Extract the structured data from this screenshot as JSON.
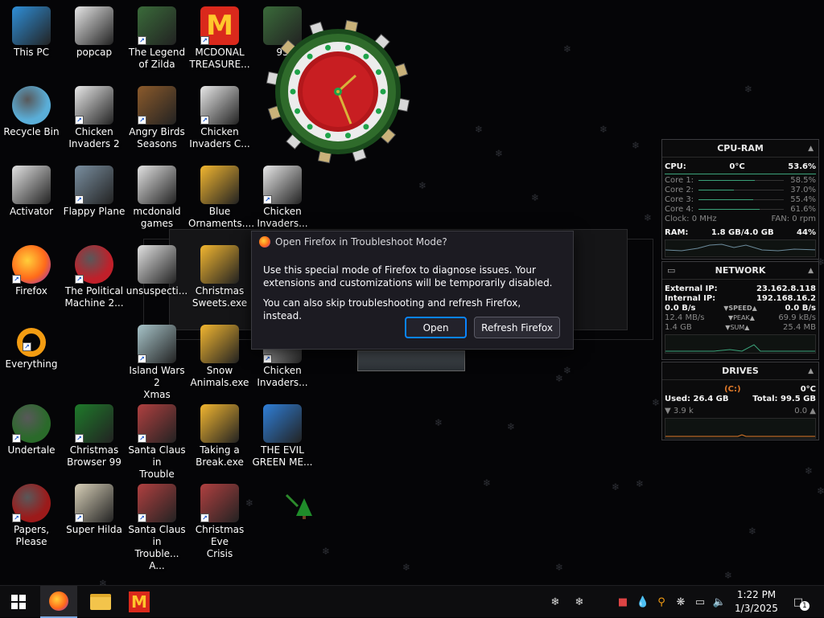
{
  "desktop_icons": [
    {
      "label": "This PC",
      "icon": "computer-icon",
      "shortcut": false
    },
    {
      "label": "popcap",
      "icon": "folder-icon",
      "shortcut": false
    },
    {
      "label": "The Legend\nof Zilda",
      "icon": "game-icon",
      "shortcut": true
    },
    {
      "label": "MCDONAL\nTREASURE...",
      "icon": "mcdonalds-icon",
      "shortcut": true
    },
    {
      "label": "95",
      "icon": "game-icon",
      "shortcut": false
    },
    {
      "label": "Recycle Bin",
      "icon": "recycle-bin-icon",
      "shortcut": false
    },
    {
      "label": "Chicken\nInvaders 2",
      "icon": "chicken-icon",
      "shortcut": true
    },
    {
      "label": "Angry Birds\nSeasons",
      "icon": "angry-birds-icon",
      "shortcut": true
    },
    {
      "label": "Chicken\nInvaders C...",
      "icon": "chicken-icon",
      "shortcut": true
    },
    {
      "label": "Activator",
      "icon": "file-icon",
      "shortcut": false
    },
    {
      "label": "Flappy Plane",
      "icon": "plane-icon",
      "shortcut": true
    },
    {
      "label": "mcdonald\ngames",
      "icon": "file-icon",
      "shortcut": false
    },
    {
      "label": "Blue\nOrnaments....",
      "icon": "installer-icon",
      "shortcut": false
    },
    {
      "label": "Chicken\nInvaders...",
      "icon": "chicken-icon",
      "shortcut": true
    },
    {
      "label": "Firefox",
      "icon": "firefox-icon",
      "shortcut": true
    },
    {
      "label": "The Political\nMachine 2...",
      "icon": "political-icon",
      "shortcut": true
    },
    {
      "label": "unsuspecti...",
      "icon": "file-icon",
      "shortcut": false
    },
    {
      "label": "Christmas\nSweets.exe",
      "icon": "installer-icon",
      "shortcut": false
    },
    {
      "label": "Everything",
      "icon": "search-icon",
      "shortcut": true
    },
    {
      "label": "Island Wars 2\nXmas",
      "icon": "island-icon",
      "shortcut": true
    },
    {
      "label": "Snow\nAnimals.exe",
      "icon": "installer-icon",
      "shortcut": false
    },
    {
      "label": "Chicken\nInvaders...",
      "icon": "chicken-icon",
      "shortcut": true
    },
    {
      "label": "Undertale",
      "icon": "undertale-icon",
      "shortcut": true
    },
    {
      "label": "Christmas\nBrowser 99",
      "icon": "tree-icon",
      "shortcut": true
    },
    {
      "label": "Santa Claus in\nTrouble",
      "icon": "santa-icon",
      "shortcut": true
    },
    {
      "label": "Taking a\nBreak.exe",
      "icon": "installer-icon",
      "shortcut": false
    },
    {
      "label": "THE EVIL\nGREEN ME...",
      "icon": "messenger-icon",
      "shortcut": false
    },
    {
      "label": "Papers, Please",
      "icon": "papers-icon",
      "shortcut": true
    },
    {
      "label": "Super Hilda",
      "icon": "hilda-icon",
      "shortcut": true
    },
    {
      "label": "Santa Claus in\nTrouble... A...",
      "icon": "santa-icon",
      "shortcut": true
    },
    {
      "label": "Christmas Eve\nCrisis",
      "icon": "santa-icon",
      "shortcut": true
    }
  ],
  "dialog": {
    "title": "Open Firefox in Troubleshoot Mode?",
    "message1": "Use this special mode of Firefox to diagnose issues. Your extensions and customizations will be temporarily disabled.",
    "message2": "You can also skip troubleshooting and refresh Firefox, instead.",
    "open_label": "Open",
    "refresh_label": "Refresh Firefox"
  },
  "cpu_ram": {
    "title": "CPU-RAM",
    "cpu_label": "CPU:",
    "cpu_temp": "0°C",
    "cpu_pct": "53.6%",
    "cores": [
      {
        "label": "Core 1:",
        "value": "58.5%"
      },
      {
        "label": "Core 2:",
        "value": "37.0%"
      },
      {
        "label": "Core 3:",
        "value": "55.4%"
      },
      {
        "label": "Core 4:",
        "value": "61.6%"
      }
    ],
    "clock": "Clock: 0 MHz",
    "fan": "FAN: 0 rpm",
    "ram_label": "RAM:",
    "ram_value": "1.8 GB/4.0 GB",
    "ram_pct": "44%"
  },
  "network": {
    "title": "NETWORK",
    "ext_label": "External IP:",
    "ext_ip": "23.162.8.118",
    "int_label": "Internal IP:",
    "int_ip": "192.168.16.2",
    "down_speed": "0.0 B/s",
    "speed_label": "SPEED",
    "up_speed": "0.0 B/s",
    "down_peak": "12.4 MB/s",
    "peak_label": "PEAK",
    "up_peak": "69.9 kB/s",
    "down_sum": "1.4 GB",
    "sum_label": "SUM",
    "up_sum": "25.4 MB"
  },
  "drives": {
    "title": "DRIVES",
    "drive": "(C:)",
    "temp": "0°C",
    "used": "Used: 26.4 GB",
    "total": "Total: 99.5 GB",
    "read": "3.9 k",
    "write": "0.0"
  },
  "taskbar": {
    "time": "1:22 PM",
    "date": "1/3/2025",
    "notification_count": "1"
  },
  "colors": {
    "accent": "#0a84ff",
    "mcdonalds_red": "#da291c",
    "mcdonalds_yellow": "#ffc72c",
    "gadget_green": "#3ba27a"
  }
}
